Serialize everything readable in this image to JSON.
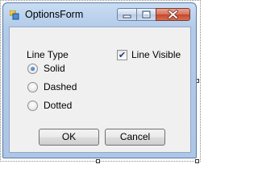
{
  "window": {
    "title": "OptionsForm",
    "minimize_glyph": "—",
    "maximize_glyph": "▭",
    "close_glyph": "✕"
  },
  "line_type": {
    "label": "Line Type",
    "options": [
      {
        "label": "Solid",
        "selected": true
      },
      {
        "label": "Dashed",
        "selected": false
      },
      {
        "label": "Dotted",
        "selected": false
      }
    ]
  },
  "line_visible": {
    "label": "Line Visible",
    "checked": true,
    "check_glyph": "✔"
  },
  "buttons": {
    "ok": "OK",
    "cancel": "Cancel"
  },
  "icons": {
    "app": "form-app-icon",
    "minimize": "minimize-icon",
    "maximize": "maximize-icon",
    "close": "close-icon"
  }
}
